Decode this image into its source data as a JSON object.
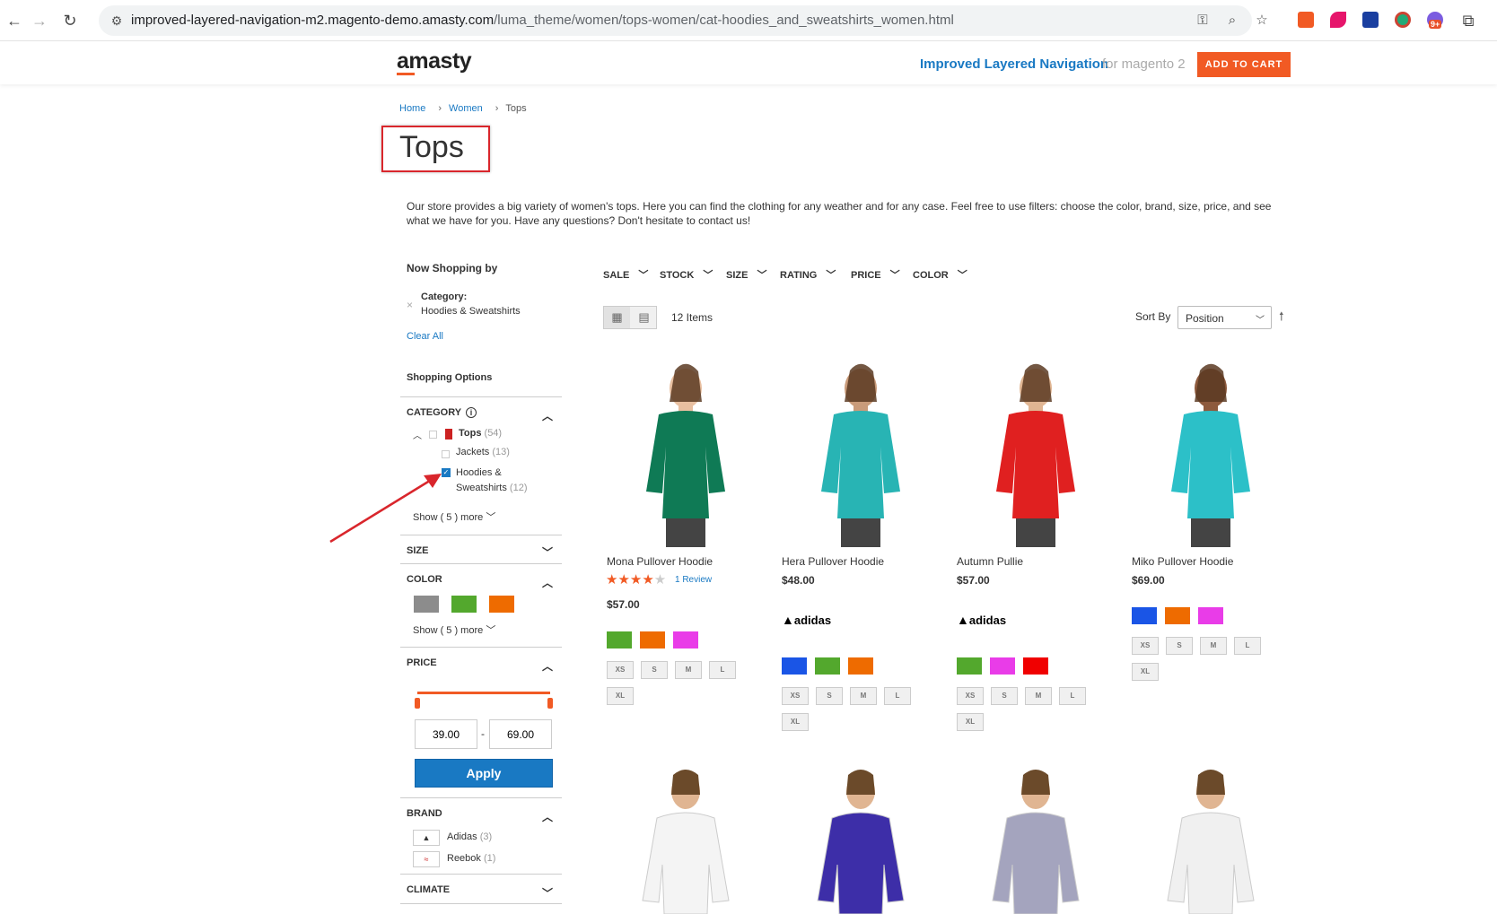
{
  "browser": {
    "url_host": "improved-layered-navigation-m2.magento-demo.amasty.com",
    "url_path": "/luma_theme/women/tops-women/cat-hoodies_and_sweatshirts_women.html",
    "ext_badge": "9+"
  },
  "header": {
    "logo": "amasty",
    "title": "Improved Layered Navigation",
    "subtitle": "for magento 2",
    "cart_button": "ADD TO CART"
  },
  "breadcrumbs": [
    "Home",
    "Women",
    "Tops"
  ],
  "page_title": "Tops",
  "description": "Our store provides a big variety of women's tops. Here you can find the clothing for any weather and for any case. Feel free to use filters: choose the color, brand, size, price, and see what we have for you. Have any questions? Don't hesitate to contact us!",
  "sidebar": {
    "now_shopping": "Now Shopping by",
    "active_filter_label": "Category:",
    "active_filter_value": "Hoodies & Sweatshirts",
    "clear_all": "Clear All",
    "shopping_options": "Shopping Options",
    "category": {
      "title": "CATEGORY",
      "items": [
        {
          "label": "Tops",
          "count": "(54)"
        },
        {
          "label": "Jackets",
          "count": "(13)"
        },
        {
          "label": "Hoodies &",
          "label2": "Sweatshirts",
          "count": "(12)"
        }
      ],
      "show_more": "Show ( 5 ) more"
    },
    "size": {
      "title": "SIZE"
    },
    "color": {
      "title": "COLOR",
      "swatches": [
        "#8c8c8c",
        "#53a82d",
        "#ee6b00"
      ],
      "show_more": "Show ( 5 ) more"
    },
    "price": {
      "title": "PRICE",
      "min": "39.00",
      "dash": "-",
      "max": "69.00",
      "apply": "Apply"
    },
    "brand": {
      "title": "BRAND",
      "items": [
        {
          "label": "Adidas",
          "count": "(3)"
        },
        {
          "label": "Reebok",
          "count": "(1)"
        }
      ]
    },
    "climate": {
      "title": "CLIMATE"
    }
  },
  "filters_bar": [
    "SALE",
    "STOCK",
    "SIZE",
    "RATING",
    "PRICE",
    "COLOR"
  ],
  "toolbar": {
    "items_count": "12 Items",
    "sort_label": "Sort By",
    "sort_value": "Position"
  },
  "products": [
    {
      "name": "Mona Pullover Hoodie",
      "review": "1  Review",
      "price": "$57.00",
      "colors": [
        "#53a82d",
        "#ee6b00",
        "#e93ce8"
      ],
      "shirt": "#0f7a55",
      "skin": "#e8bfa0"
    },
    {
      "name": "Hera Pullover Hoodie",
      "price": "$48.00",
      "brand": "adidas",
      "colors": [
        "#1a55e6",
        "#53a82d",
        "#ee6b00"
      ],
      "shirt": "#28b4b4",
      "skin": "#c99b7a"
    },
    {
      "name": "Autumn Pullie",
      "price": "$57.00",
      "brand": "adidas",
      "colors": [
        "#53a82d",
        "#e93ce8",
        "#f00000"
      ],
      "shirt": "#e02020",
      "skin": "#e0b592"
    },
    {
      "name": "Miko Pullover Hoodie",
      "price": "$69.00",
      "colors": [
        "#1a55e6",
        "#ee6b00",
        "#e93ce8"
      ],
      "shirt": "#2cc0c8",
      "skin": "#8d5a3d"
    }
  ],
  "sizes": [
    "XS",
    "S",
    "M",
    "L",
    "XL"
  ],
  "bottom_products": [
    {
      "shirt": "#f4f4f4"
    },
    {
      "shirt": "#3d2ea8"
    },
    {
      "shirt": "#a4a4be"
    },
    {
      "shirt": "#f0f0f0"
    }
  ]
}
